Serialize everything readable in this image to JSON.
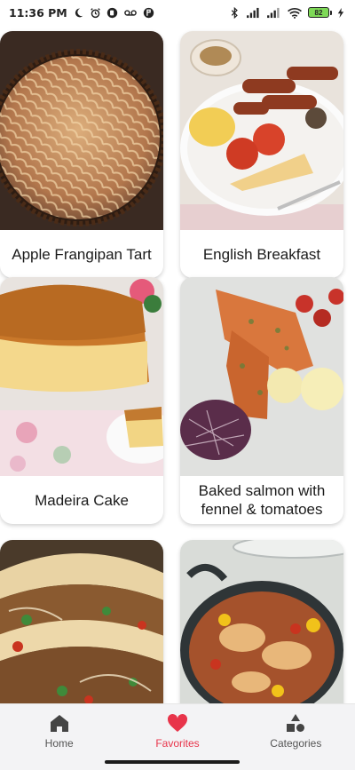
{
  "status_bar": {
    "time": "11:36 PM",
    "battery_level": "82",
    "icons": [
      "moon-icon",
      "alarm-icon",
      "app-notification-icon",
      "voicemail-icon",
      "app-notification-icon",
      "bluetooth-icon",
      "signal-icon",
      "signal-icon",
      "wifi-icon",
      "battery-icon",
      "charging-icon"
    ]
  },
  "meals": [
    {
      "title": "Apple Frangipan Tart",
      "image": "apple-tart-photo"
    },
    {
      "title": "English Breakfast",
      "image": "english-breakfast-photo"
    },
    {
      "title": "Madeira Cake",
      "image": "madeira-cake-photo"
    },
    {
      "title": "Baked salmon with fennel & tomatoes",
      "image": "baked-salmon-photo"
    },
    {
      "title": "",
      "image": "tacos-photo"
    },
    {
      "title": "",
      "image": "chicken-casserole-photo"
    }
  ],
  "bottom_nav": {
    "items": [
      {
        "label": "Home",
        "icon": "home-icon",
        "active": false
      },
      {
        "label": "Favorites",
        "icon": "heart-icon",
        "active": true
      },
      {
        "label": "Categories",
        "icon": "shapes-icon",
        "active": false
      }
    ],
    "active_color": "#e8344a",
    "inactive_color": "#555555"
  }
}
